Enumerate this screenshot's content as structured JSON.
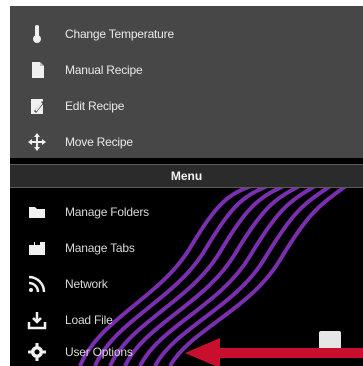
{
  "top_menu": {
    "items": [
      {
        "label": "Change Temperature",
        "icon": "thermometer-icon"
      },
      {
        "label": "Manual Recipe",
        "icon": "document-icon"
      },
      {
        "label": "Edit Recipe",
        "icon": "edit-icon"
      },
      {
        "label": "Move Recipe",
        "icon": "move-icon"
      }
    ]
  },
  "menu_bar": {
    "title": "Menu"
  },
  "bottom_menu": {
    "items": [
      {
        "label": "Manage Folders",
        "icon": "folder-icon"
      },
      {
        "label": "Manage Tabs",
        "icon": "tabs-icon"
      },
      {
        "label": "Network",
        "icon": "network-icon"
      },
      {
        "label": "Load File",
        "icon": "load-file-icon"
      },
      {
        "label": "User Options",
        "icon": "gear-icon"
      }
    ]
  },
  "colors": {
    "top_panel": "#474747",
    "bottom_panel": "#000000",
    "swirl": "#7b2fb0",
    "arrow": "#c8102e"
  }
}
